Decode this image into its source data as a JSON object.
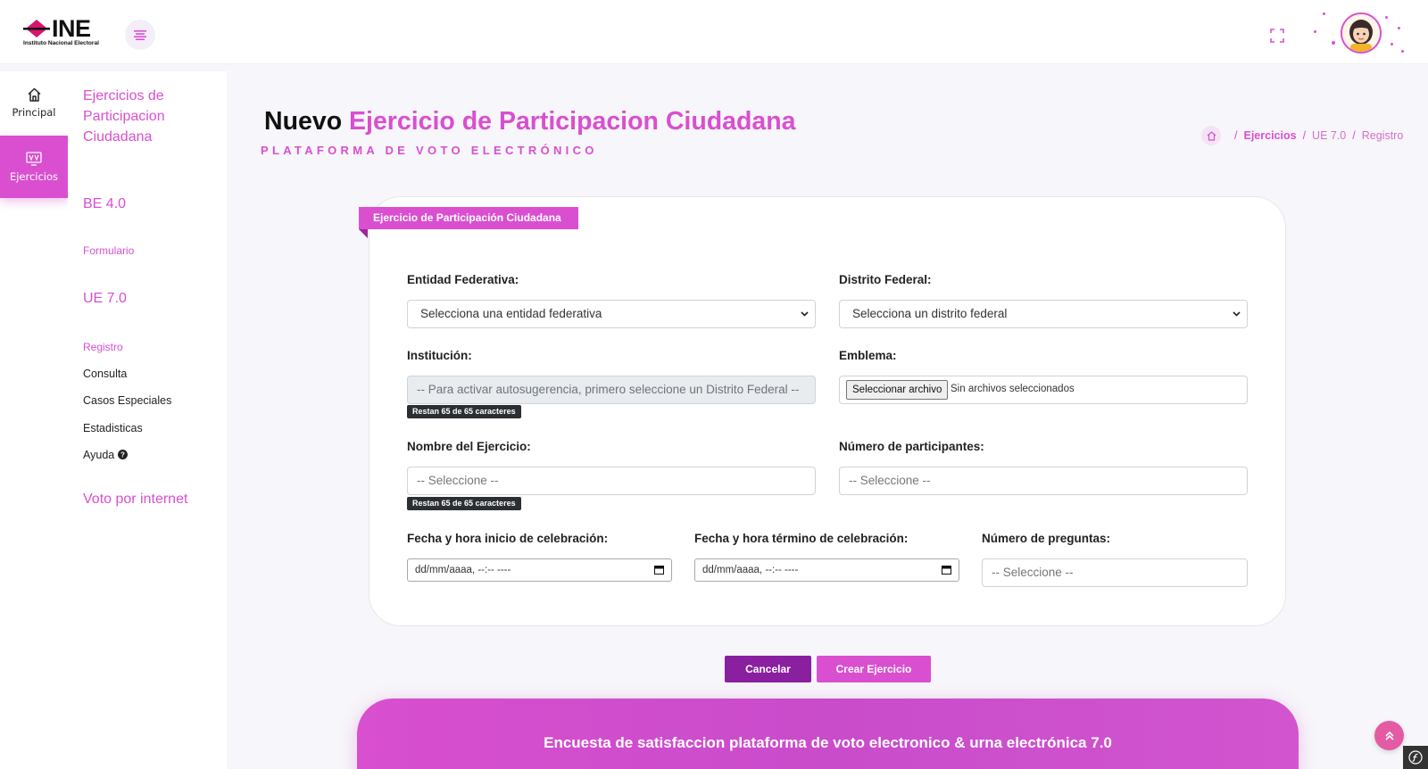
{
  "header": {
    "logo_text": "INE",
    "logo_sub": "Instituto Nacional Electoral",
    "menu_icon": "hamburger-icon",
    "fullscreen_icon": "fullscreen-icon",
    "accent_color": "#d94fd0"
  },
  "rail": {
    "principal_label": "Principal",
    "ejercicios_label": "Ejercicios"
  },
  "submenu": {
    "section_title": "Ejercicios de Participacion Ciudadana",
    "be_title": "BE 4.0",
    "be_items": [
      "Formulario"
    ],
    "ue_title": "UE 7.0",
    "ue_items": [
      "Registro",
      "Consulta",
      "Casos Especiales",
      "Estadisticas",
      "Ayuda"
    ],
    "voto_title": "Voto por internet"
  },
  "page": {
    "title_part1": "Nuevo",
    "title_part2": "Ejercicio de Participacion Ciudadana",
    "subtitle": "PLATAFORMA DE VOTO ELECTRÓNICO"
  },
  "breadcrumb": {
    "home_icon": "home-icon",
    "items": [
      "Ejercicios",
      "UE 7.0",
      "Registro"
    ],
    "separator": "/"
  },
  "form": {
    "ribbon": "Ejercicio de Participación Ciudadana",
    "entidad_label": "Entidad Federativa:",
    "entidad_value": "Selecciona una entidad federativa",
    "distrito_label": "Distrito Federal:",
    "distrito_value": "Selecciona un distrito federal",
    "institucion_label": "Institución:",
    "institucion_placeholder": "-- Para activar autosugerencia, primero seleccione un Distrito Federal --",
    "institucion_counter": "Restan 65 de 65 caracteres",
    "emblema_label": "Emblema:",
    "emblema_button": "Seleccionar archivo",
    "emblema_status": "Sin archivos seleccionados",
    "nombre_label": "Nombre del Ejercicio:",
    "nombre_placeholder": "-- Seleccione --",
    "nombre_counter": "Restan 65 de 65 caracteres",
    "participantes_label": "Número de participantes:",
    "participantes_placeholder": "-- Seleccione --",
    "fecha_inicio_label": "Fecha y hora inicio de celebración:",
    "fecha_inicio_placeholder": "dd/mm/aaaa, --:-- ----",
    "fecha_termino_label": "Fecha y hora término de celebración:",
    "fecha_termino_placeholder": "dd/mm/aaaa, --:-- ----",
    "preguntas_label": "Número de preguntas:",
    "preguntas_placeholder": "-- Seleccione --"
  },
  "actions": {
    "cancel_label": "Cancelar",
    "create_label": "Crear Ejercicio"
  },
  "banner": {
    "text": "Encuesta de satisfaccion plataforma de voto electronico & urna electrónica 7.0"
  }
}
